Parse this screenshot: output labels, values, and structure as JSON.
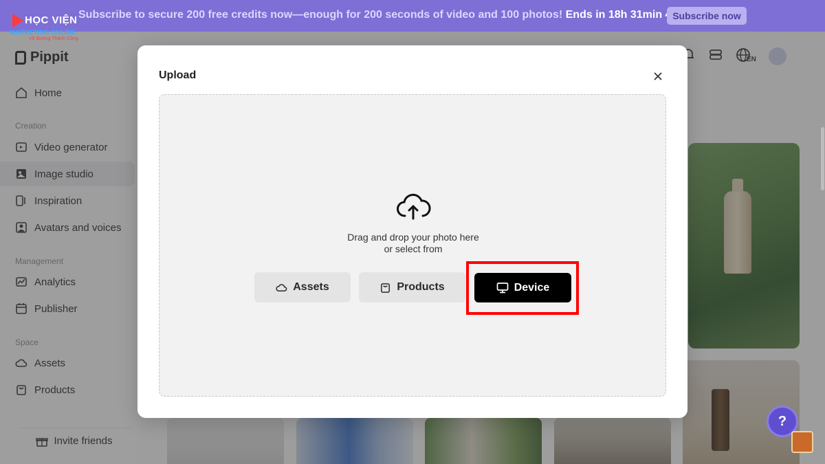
{
  "banner": {
    "text": "Subscribe to secure 200 free credits now—enough for 200 seconds of video and 100 photos! ",
    "countdown": "Ends in 18h 31min 43s",
    "button_label": "Subscribe now"
  },
  "watermark": {
    "line1": "HỌC VIỆN",
    "line2": "MARKETING ONLINE",
    "line3": "Vẽ đường Thành Công"
  },
  "sidebar": {
    "brand": "Pippit",
    "home": "Home",
    "sections": {
      "creation": "Creation",
      "management": "Management",
      "space": "Space"
    },
    "items": [
      {
        "label": "Video generator",
        "icon": "video-plus-icon"
      },
      {
        "label": "Image studio",
        "icon": "image-studio-icon",
        "active": true
      },
      {
        "label": "Inspiration",
        "icon": "inspiration-icon"
      },
      {
        "label": "Avatars and voices",
        "icon": "avatar-icon"
      },
      {
        "label": "Analytics",
        "icon": "analytics-icon"
      },
      {
        "label": "Publisher",
        "icon": "calendar-icon"
      },
      {
        "label": "Assets",
        "icon": "cloud-icon"
      },
      {
        "label": "Products",
        "icon": "bag-icon"
      }
    ],
    "invite_label": "Invite friends"
  },
  "topbar": {
    "language": "EN"
  },
  "modal": {
    "title": "Upload",
    "drop_line1": "Drag and drop your photo here",
    "drop_line2": "or select from",
    "buttons": {
      "assets": "Assets",
      "products": "Products",
      "device": "Device"
    }
  },
  "help_label": "?",
  "colors": {
    "banner": "#7d6fd6",
    "device_button": "#000000",
    "highlight": "#ff0000",
    "help": "#5f4fd0"
  }
}
